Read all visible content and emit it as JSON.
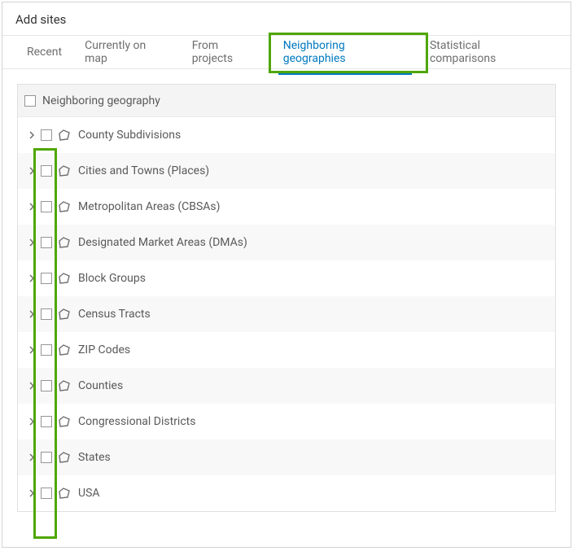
{
  "title": "Add sites",
  "tabs": [
    {
      "label": "Recent"
    },
    {
      "label": "Currently on map"
    },
    {
      "label": "From projects"
    },
    {
      "label": "Neighboring geographies"
    },
    {
      "label": "Statistical comparisons"
    }
  ],
  "tree": {
    "header": "Neighboring geography",
    "rows": [
      {
        "label": "County Subdivisions"
      },
      {
        "label": "Cities and Towns (Places)"
      },
      {
        "label": "Metropolitan Areas (CBSAs)"
      },
      {
        "label": "Designated Market Areas (DMAs)"
      },
      {
        "label": "Block Groups"
      },
      {
        "label": "Census Tracts"
      },
      {
        "label": "ZIP Codes"
      },
      {
        "label": "Counties"
      },
      {
        "label": "Congressional Districts"
      },
      {
        "label": "States"
      },
      {
        "label": "USA"
      }
    ]
  }
}
